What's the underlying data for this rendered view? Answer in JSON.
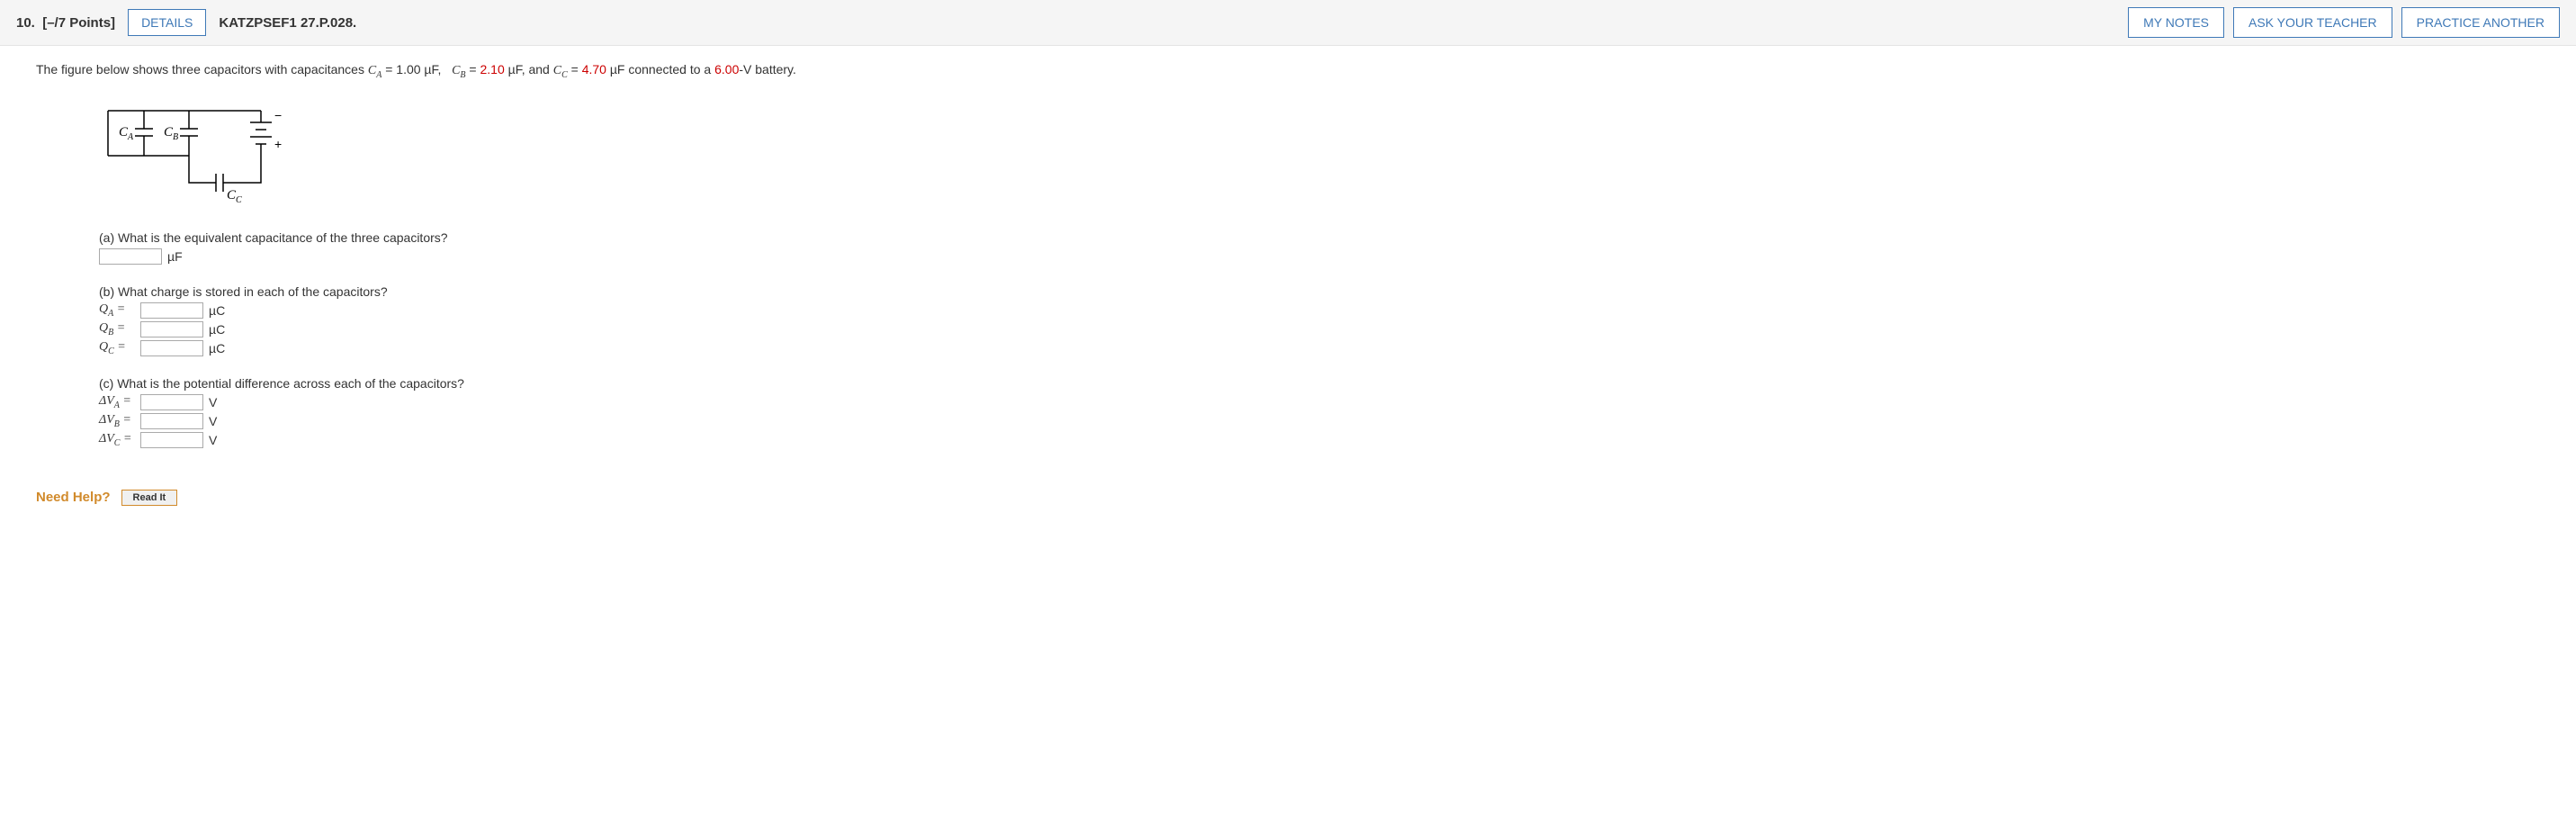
{
  "header": {
    "question_prefix": "10.",
    "points": "[–/7 Points]",
    "details_label": "DETAILS",
    "source": "KATZPSEF1 27.P.028.",
    "my_notes": "MY NOTES",
    "ask_teacher": "ASK YOUR TEACHER",
    "practice_another": "PRACTICE ANOTHER"
  },
  "prompt": {
    "intro": "The figure below shows three capacitors with capacitances  ",
    "ca_val": "1.00",
    "cb_val": "2.10",
    "cc_val": "4.70",
    "unit1": " µF,",
    "unit2": " µF,  and  ",
    "unit3": " µF",
    "connect": "  connected to a ",
    "voltage": "6.00",
    "voltage_suffix": "-V battery."
  },
  "figure": {
    "label_ca": "C",
    "label_cb": "C",
    "label_cc": "C",
    "minus": "−",
    "plus": "+"
  },
  "part_a": {
    "q": "(a) What is the equivalent capacitance of the three capacitors?",
    "unit": "µF"
  },
  "part_b": {
    "q": "(b) What charge is stored in each of the capacitors?",
    "unit": "µC",
    "labels": {
      "qa": "Q",
      "qb": "Q",
      "qc": "Q"
    }
  },
  "part_c": {
    "q": "(c) What is the potential difference across each of the capacitors?",
    "unit": "V",
    "labels": {
      "va": "ΔV",
      "vb": "ΔV",
      "vc": "ΔV"
    }
  },
  "help": {
    "label": "Need Help?",
    "read_it": "Read It"
  }
}
